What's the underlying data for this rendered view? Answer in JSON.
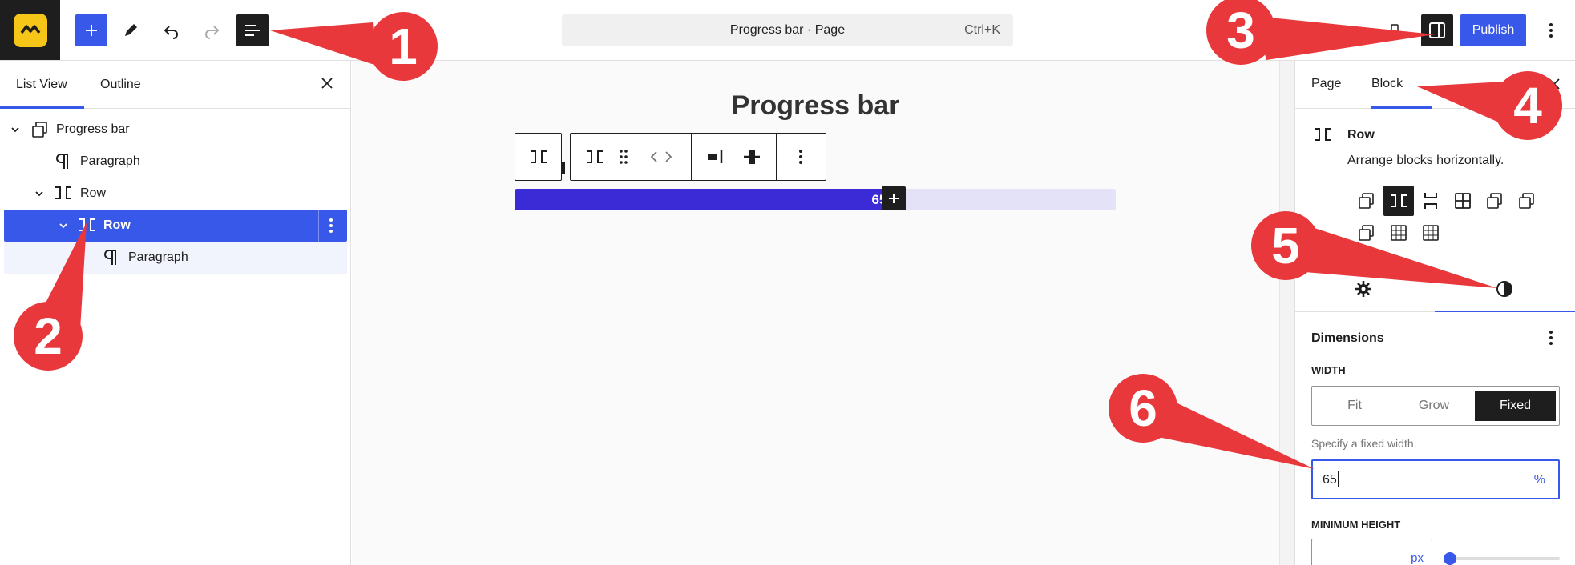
{
  "topbar": {
    "command_title": "Progress bar · Page",
    "command_shortcut": "Ctrl+K",
    "publish_label": "Publish"
  },
  "left_panel": {
    "tabs": [
      "List View",
      "Outline"
    ],
    "tree": [
      {
        "label": "Progress bar",
        "icon": "synced-pattern-icon"
      },
      {
        "label": "Paragraph",
        "icon": "pilcrow-icon"
      },
      {
        "label": "Row",
        "icon": "row-icon"
      },
      {
        "label": "Row",
        "icon": "row-icon",
        "selected": true
      },
      {
        "label": "Paragraph",
        "icon": "pilcrow-icon"
      }
    ]
  },
  "canvas": {
    "page_title": "Progress bar",
    "progress_percent": 65,
    "progress_label": "65%"
  },
  "right_panel": {
    "tabs": [
      "Page",
      "Block"
    ],
    "block_name": "Row",
    "block_description": "Arrange blocks horizontally.",
    "dimensions_title": "Dimensions",
    "width_label": "WIDTH",
    "width_options": [
      "Fit",
      "Grow",
      "Fixed"
    ],
    "width_selected": "Fixed",
    "width_help": "Specify a fixed width.",
    "width_value": "65",
    "width_unit": "%",
    "min_height_label": "MINIMUM HEIGHT",
    "min_height_unit": "px"
  },
  "annotations": [
    "1",
    "2",
    "3",
    "4",
    "5",
    "6"
  ],
  "colors": {
    "accent": "#3858e9",
    "annotation_red": "#e8383b",
    "progress_fill": "#3b2bd6",
    "logo_yellow": "#f5c518"
  }
}
